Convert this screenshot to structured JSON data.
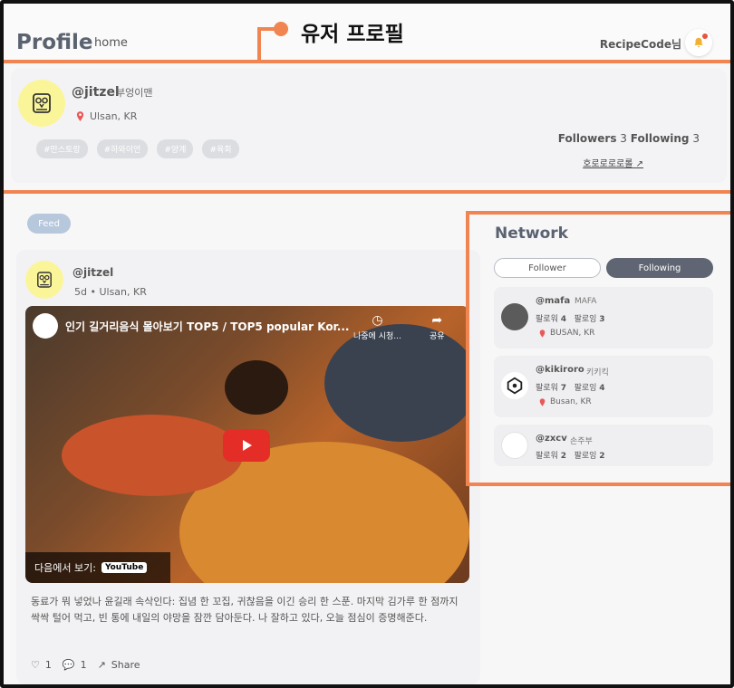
{
  "header": {
    "brand": "Profile",
    "nav_home": "home",
    "user_name": "RecipeCode님"
  },
  "annotations": {
    "profile_callout": "유저 프로필"
  },
  "profile": {
    "handle": "@jitzel",
    "nickname": "부엉이맨",
    "location": "Ulsan, KR",
    "tags": [
      "#만스토랑",
      "#하와이언",
      "#양계",
      "#육회"
    ],
    "followers_label": "Followers",
    "followers_count": "3",
    "following_label": "Following",
    "following_count": "3",
    "bio_link": "호로로로로롤"
  },
  "feed": {
    "pill": "Feed",
    "post": {
      "handle": "@jitzel",
      "meta": "5d • Ulsan, KR",
      "video": {
        "title": "인기 길거리음식 몰아보기 TOP5 / TOP5 popular Kor...",
        "watch_later": "나중에 시청...",
        "share": "공유",
        "watch_on": "다음에서 보기:",
        "yt_label": "YouTube"
      },
      "text": "동료가 뭐 넣었나 윤길래 속삭인다: 집념 한 꼬집, 귀찮음을 이긴 승리 한 스푼. 마지막 김가루 한 점까지 싹싹 털어 먹고, 빈 통에 내일의 야망을 잠깐 담아둔다. 나 잘하고 있다, 오늘 점심이 증명해준다.",
      "likes": "1",
      "comments": "1",
      "share_label": "Share"
    }
  },
  "network": {
    "title": "Network",
    "tab_follower": "Follower",
    "tab_following": "Following",
    "items": [
      {
        "handle": "@mafa",
        "nick": "MAFA",
        "follower_label": "팔로워",
        "follower_count": "4",
        "following_label": "팔로잉",
        "following_count": "3",
        "location": "BUSAN, KR"
      },
      {
        "handle": "@kikiroro",
        "nick": "키키킥",
        "follower_label": "팔로워",
        "follower_count": "7",
        "following_label": "팔로잉",
        "following_count": "4",
        "location": "Busan, KR"
      },
      {
        "handle": "@zxcv",
        "nick": "손주부",
        "follower_label": "팔로워",
        "follower_count": "2",
        "following_label": "팔로잉",
        "following_count": "2",
        "location": ""
      }
    ]
  },
  "colors": {
    "accent": "#f08552",
    "avatar_bg": "#fbf59a",
    "feed_pill": "#b7c7dc",
    "tab_active": "#5f6572"
  }
}
